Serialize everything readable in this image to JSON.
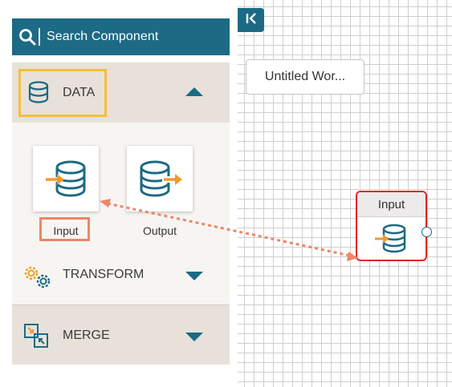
{
  "search": {
    "label": "Search Component",
    "icon": "search-icon"
  },
  "sections": {
    "data": {
      "label": "DATA",
      "icon": "database-icon",
      "state": "expanded"
    },
    "transform": {
      "label": "TRANSFORM",
      "icon": "gears-icon",
      "state": "collapsed"
    },
    "merge": {
      "label": "MERGE",
      "icon": "merge-icon",
      "state": "collapsed"
    }
  },
  "components": [
    {
      "label": "Input",
      "icon": "database-input-icon"
    },
    {
      "label": "Output",
      "icon": "database-output-icon"
    }
  ],
  "canvas": {
    "workflow_tab": "Untitled Wor...",
    "node": {
      "label": "Input",
      "icon": "database-input-icon"
    }
  },
  "colors": {
    "primary": "#1c6a84",
    "accent": "#f39a2b",
    "highlight_yellow": "#f2bf3a",
    "highlight_salmon": "#ef8467",
    "node_border": "#e02424"
  }
}
